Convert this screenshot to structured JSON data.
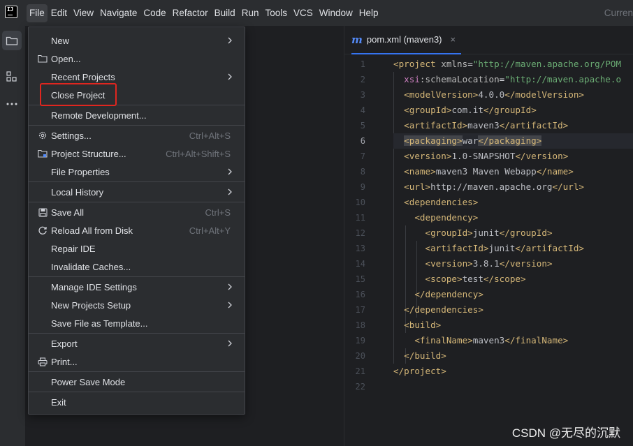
{
  "menubar": {
    "logo_text": "IJ",
    "items": [
      {
        "label": "File",
        "active": true
      },
      {
        "label": "Edit"
      },
      {
        "label": "View"
      },
      {
        "label": "Navigate"
      },
      {
        "label": "Code"
      },
      {
        "label": "Refactor"
      },
      {
        "label": "Build"
      },
      {
        "label": "Run"
      },
      {
        "label": "Tools"
      },
      {
        "label": "VCS"
      },
      {
        "label": "Window"
      },
      {
        "label": "Help"
      }
    ],
    "right_label": "Curren"
  },
  "left_toolbar": {
    "icons": [
      "project-folder-icon",
      "structure-icon",
      "more-icon"
    ]
  },
  "file_menu": {
    "items": [
      {
        "label": "New",
        "submenu": true
      },
      {
        "label": "Open...",
        "icon": "folder-icon"
      },
      {
        "label": "Recent Projects",
        "submenu": true
      },
      {
        "label": "Close Project",
        "highlighted": true
      },
      {
        "label": "Remote Development..."
      },
      {
        "label": "Settings...",
        "icon": "gear-icon",
        "shortcut": "Ctrl+Alt+S"
      },
      {
        "label": "Project Structure...",
        "icon": "project-structure-icon",
        "shortcut": "Ctrl+Alt+Shift+S"
      },
      {
        "label": "File Properties",
        "submenu": true
      },
      {
        "label": "Local History",
        "submenu": true
      },
      {
        "label": "Save All",
        "icon": "save-icon",
        "shortcut": "Ctrl+S"
      },
      {
        "label": "Reload All from Disk",
        "icon": "reload-icon",
        "shortcut": "Ctrl+Alt+Y"
      },
      {
        "label": "Repair IDE"
      },
      {
        "label": "Invalidate Caches..."
      },
      {
        "label": "Manage IDE Settings",
        "submenu": true
      },
      {
        "label": "New Projects Setup",
        "submenu": true
      },
      {
        "label": "Save File as Template..."
      },
      {
        "label": "Export",
        "submenu": true
      },
      {
        "label": "Print...",
        "icon": "print-icon"
      },
      {
        "label": "Power Save Mode"
      },
      {
        "label": "Exit"
      }
    ]
  },
  "editor": {
    "tab": {
      "icon": "maven-icon",
      "icon_glyph": "m",
      "label": "pom.xml (maven3)",
      "close": "×"
    },
    "current_line": 6,
    "line_numbers": [
      "1",
      "2",
      "3",
      "4",
      "5",
      "6",
      "7",
      "8",
      "9",
      "10",
      "11",
      "12",
      "13",
      "14",
      "15",
      "16",
      "17",
      "18",
      "19",
      "20",
      "21",
      "22"
    ],
    "lines": [
      "<project xmlns=\"http://maven.apache.org/POM",
      "  xsi:schemaLocation=\"http://maven.apache.o",
      "  <modelVersion>4.0.0</modelVersion>",
      "  <groupId>com.it</groupId>",
      "  <artifactId>maven3</artifactId>",
      "  <packaging>war</packaging>",
      "  <version>1.0-SNAPSHOT</version>",
      "  <name>maven3 Maven Webapp</name>",
      "  <url>http://maven.apache.org</url>",
      "  <dependencies>",
      "    <dependency>",
      "      <groupId>junit</groupId>",
      "      <artifactId>junit</artifactId>",
      "      <version>3.8.1</version>",
      "      <scope>test</scope>",
      "    </dependency>",
      "  </dependencies>",
      "  <build>",
      "    <finalName>maven3</finalName>",
      "  </build>",
      "</project>",
      ""
    ]
  },
  "watermark": "CSDN @无尽的沉默",
  "colors": {
    "background": "#1e1f22",
    "panel": "#2b2d30",
    "tag": "#d5b778",
    "string": "#6aab73",
    "highlight_box": "#e0261f",
    "accent": "#3574f0"
  }
}
